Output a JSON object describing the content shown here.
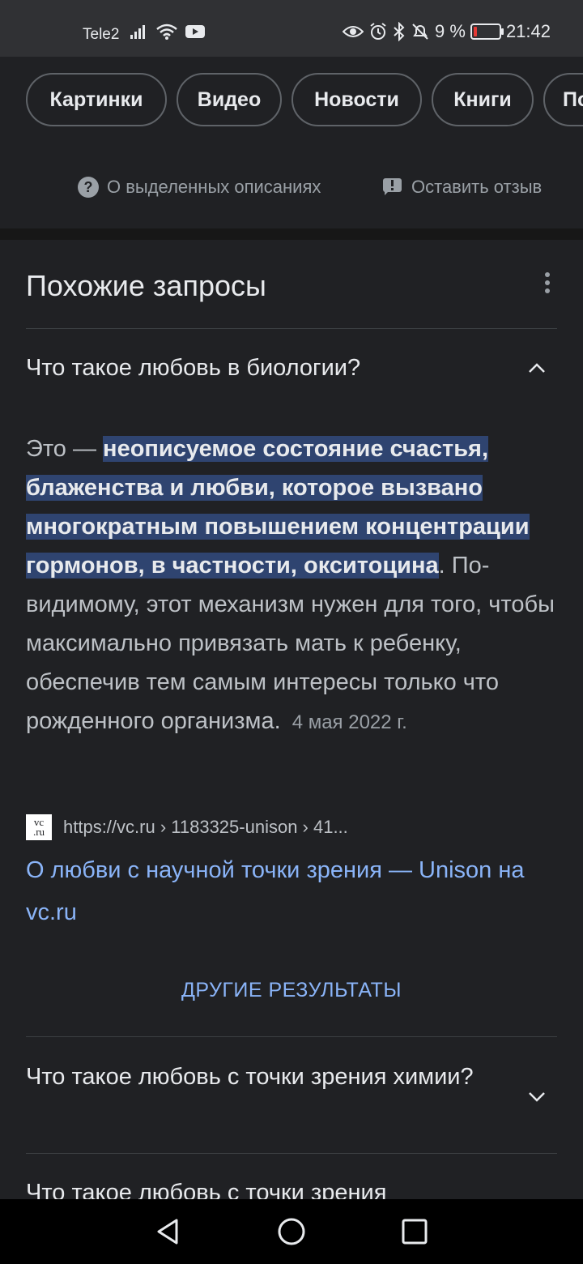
{
  "status_bar": {
    "carrier": "Tele2",
    "battery": "9 %",
    "time": "21:42",
    "icons": [
      "signal-icon",
      "wifi-icon",
      "youtube-icon",
      "eye-icon",
      "alarm-icon",
      "bluetooth-icon",
      "mute-icon",
      "battery-icon"
    ]
  },
  "chips": [
    "Картинки",
    "Видео",
    "Новости",
    "Книги",
    "По"
  ],
  "feedback": {
    "about_label": "О выделенных описаниях",
    "feedback_label": "Оставить отзыв"
  },
  "related": {
    "title": "Похожие запросы",
    "q1": "Что такое любовь в биологии?",
    "answer": {
      "prefix": "Это — ",
      "highlight": "неописуемое состояние счастья, блаженства и любви, которое вызвано многократным повышением концентрации гормонов, в частности, окситоцина",
      "suffix": ". По-видимому, этот механизм нужен для того, чтобы максимально привязать мать к ребенку, обеспечив тем самым интересы только что рожденного организма.",
      "date": "4 мая 2022 г."
    },
    "source": {
      "favicon_text_top": "vc",
      "favicon_text_bottom": ".ru",
      "url": "https://vc.ru › 1183325-unison › 41...",
      "link": "О любви с научной точки зрения — Unison на vc.ru"
    },
    "more_results": "ДРУГИЕ РЕЗУЛЬТАТЫ",
    "q2": "Что такое любовь с точки зрения химии?",
    "q3": "Что такое любовь с точки зрения"
  },
  "colors": {
    "background": "#202124",
    "link": "#8ab4f8",
    "highlight": "#2f4470"
  }
}
